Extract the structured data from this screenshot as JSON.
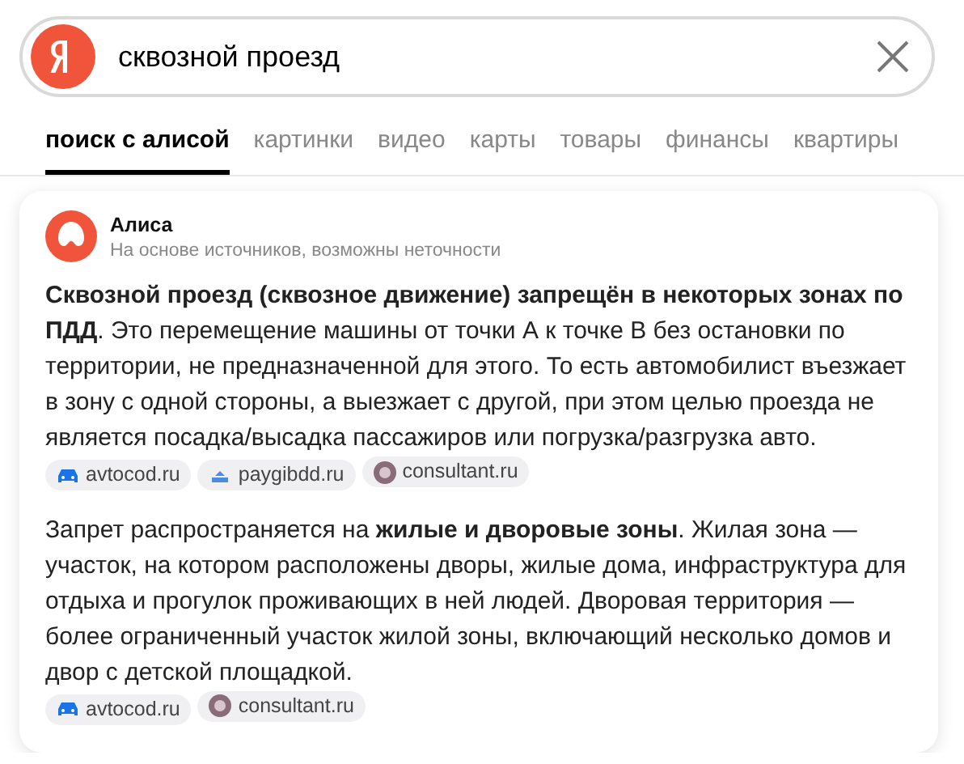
{
  "search": {
    "value": "сквозной проезд"
  },
  "tabs": [
    {
      "label": "поиск с алисой",
      "selected": true
    },
    {
      "label": "картинки",
      "selected": false
    },
    {
      "label": "видео",
      "selected": false
    },
    {
      "label": "карты",
      "selected": false
    },
    {
      "label": "товары",
      "selected": false
    },
    {
      "label": "финансы",
      "selected": false
    },
    {
      "label": "квартиры",
      "selected": false
    }
  ],
  "answer": {
    "author": "Алиса",
    "disclaimer": "На основе источников, возможны неточности",
    "paragraphs": [
      {
        "text": "**Сквозной проезд (сквозное движение) запрещён в некоторых зонах по ПДД**. Это перемещение машины от точки А к точке В без остановки по территории, не предназначенной для этого. То есть автомобилист въезжает в зону с одной стороны, а выезжает с другой, при этом целью проезда не является посадка/высадка пассажиров или погрузка/разгрузка авто.",
        "sources": [
          {
            "label": "avtocod.ru",
            "kind": "car"
          },
          {
            "label": "paygibdd.ru",
            "kind": "gibdd"
          },
          {
            "label": "consultant.ru",
            "kind": "consultant"
          }
        ]
      },
      {
        "text": "Запрет распространяется на **жилые и дворовые зоны**. Жилая зона — участок, на котором расположены дворы, жилые дома, инфраструктура для отдыха и прогулок проживающих в ней людей. Дворовая территория — более ограниченный участок жилой зоны, включающий несколько домов и двор с детской площадкой.",
        "sources": [
          {
            "label": "avtocod.ru",
            "kind": "car"
          },
          {
            "label": "consultant.ru",
            "kind": "consultant"
          }
        ]
      }
    ]
  }
}
